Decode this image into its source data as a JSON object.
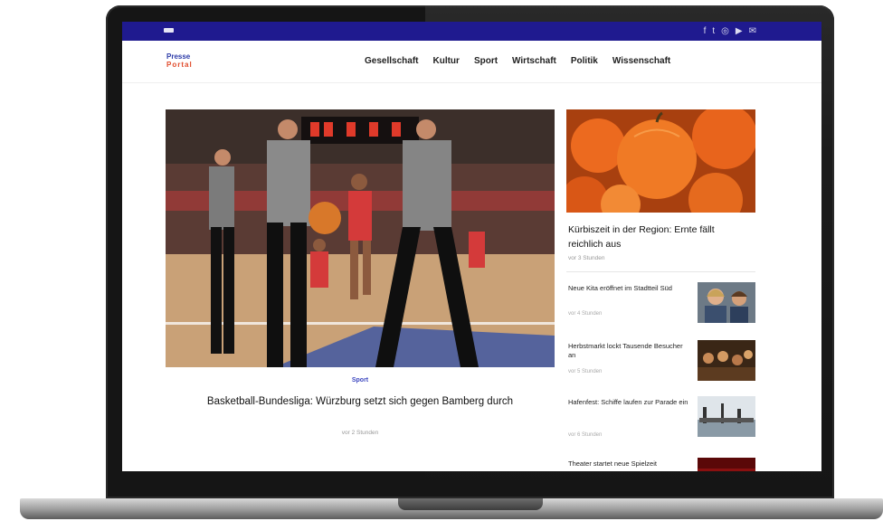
{
  "topbar": {
    "social_icons": [
      "facebook-icon",
      "twitter-icon",
      "instagram-icon",
      "youtube-icon",
      "mail-icon"
    ],
    "social_glyphs": [
      "f",
      "t",
      "◎",
      "▶",
      "✉"
    ]
  },
  "site": {
    "logo_line1": "Presse",
    "logo_line2": "Portal"
  },
  "nav": [
    "Gesellschaft",
    "Kultur",
    "Sport",
    "Wirtschaft",
    "Politik",
    "Wissenschaft"
  ],
  "hero": {
    "category": "Sport",
    "title": "Basketball-Bundesliga: Würzburg setzt sich gegen Bamberg durch",
    "meta": "vor 2 Stunden"
  },
  "feature": {
    "title": "Kürbiszeit in der Region: Ernte fällt reichlich aus",
    "meta": "vor 3 Stunden"
  },
  "cards": [
    {
      "title": "Neue Kita eröffnet im Stadtteil Süd",
      "meta": "vor 4 Stunden",
      "thumb": "people"
    },
    {
      "title": "Herbstmarkt lockt Tausende Besucher an",
      "meta": "vor 5 Stunden",
      "thumb": "crowd"
    },
    {
      "title": "Hafenfest: Schiffe laufen zur Parade ein",
      "meta": "vor 6 Stunden",
      "thumb": "harbor"
    },
    {
      "title": "Theater startet neue Spielzeit",
      "meta": "",
      "thumb": "theater"
    }
  ],
  "colors": {
    "topbar": "#1f1a8f",
    "accent": "#3d47c0",
    "logo_red": "#e04a2a"
  }
}
